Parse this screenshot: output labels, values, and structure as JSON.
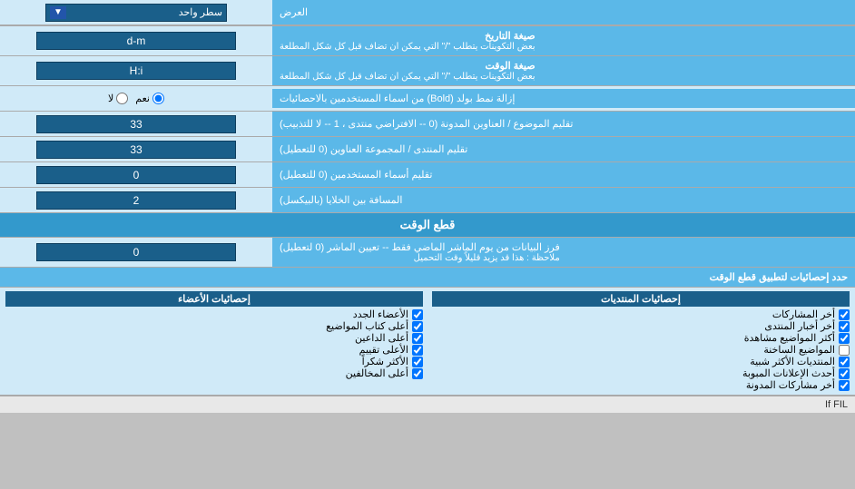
{
  "header": {
    "top_label": "العرض",
    "dropdown_label": "سطر واحد",
    "dropdown_arrow": "▼"
  },
  "rows": [
    {
      "id": "date-format",
      "label": "صيغة التاريخ\nبعض التكوينات يتطلب \"/\" التي يمكن ان تضاف قبل كل شكل المطلعة",
      "label_line1": "صيغة التاريخ",
      "label_line2": "بعض التكوينات يتطلب \"/\" التي يمكن ان تضاف قبل كل شكل المطلعة",
      "value": "d-m"
    },
    {
      "id": "time-format",
      "label_line1": "صيغة الوقت",
      "label_line2": "بعض التكوينات يتطلب \"/\" التي يمكن ان تضاف قبل كل شكل المطلعة",
      "value": "H:i"
    },
    {
      "id": "topics-titles",
      "label_line1": "تقليم الموضوع / العناوين المدونة (0 -- الافتراضي منتدى ، 1 -- لا للتذبيب)",
      "label_line2": "",
      "value": "33"
    },
    {
      "id": "forum-titles",
      "label_line1": "تقليم المنتدى / المجموعة العناوين (0 للتعطيل)",
      "label_line2": "",
      "value": "33"
    },
    {
      "id": "user-names",
      "label_line1": "تقليم أسماء المستخدمين (0 للتعطيل)",
      "label_line2": "",
      "value": "0"
    },
    {
      "id": "cell-spacing",
      "label_line1": "المسافة بين الخلايا (بالبيكسل)",
      "label_line2": "",
      "value": "2"
    }
  ],
  "radio_row": {
    "label": "إزالة نمط بولد (Bold) من اسماء المستخدمين بالاحصائيات",
    "options": [
      "نعم",
      "لا"
    ],
    "selected": "نعم"
  },
  "realtime_section": {
    "title": "قطع الوقت",
    "row": {
      "label_line1": "فرز البيانات من يوم الماشر الماضي فقط -- تعيين الماشر (0 لتعطيل)",
      "label_line2": "ملاحظة : هذا قد يزيد قليلاً وقت التحميل",
      "value": "0"
    },
    "bottom_label": "حدد إحصائيات لتطبيق قطع الوقت"
  },
  "checkboxes": {
    "col1": {
      "header": "إحصائيات المنتديات",
      "items": [
        "أخر المشاركات",
        "أخر أخبار المنتدى",
        "أكثر المواضيع مشاهدة",
        "المواضيع الساخنة",
        "المنتديات الأكثر شبية",
        "أحدث الإعلانات المبوبة",
        "أخر مشاركات المدونة"
      ]
    },
    "col2": {
      "header": "إحصائيات الأعضاء",
      "items": [
        "الأعضاء الجدد",
        "أعلى كتاب المواضيع",
        "أعلى الداعين",
        "الأعلى تقييم",
        "الأكثر شكراً",
        "أعلى المخالفين"
      ]
    }
  },
  "bottom_note": "If FIL"
}
